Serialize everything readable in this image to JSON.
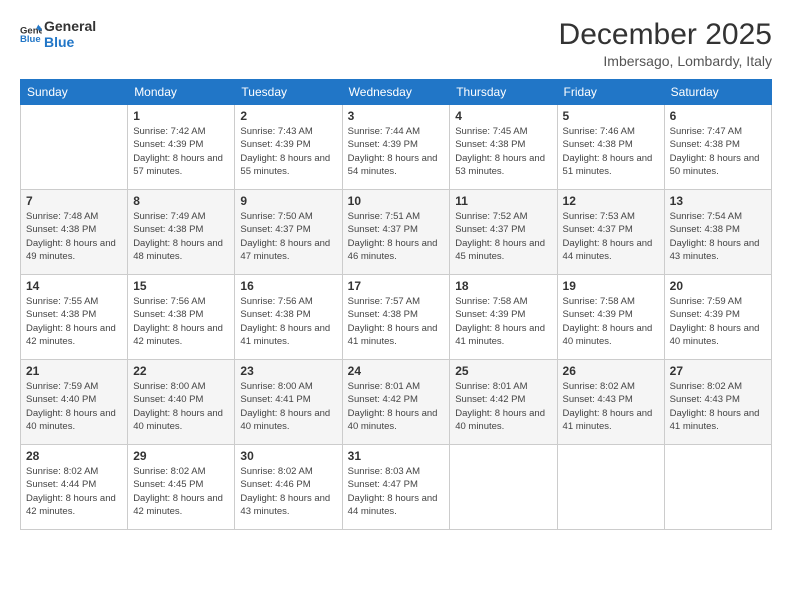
{
  "logo": {
    "line1": "General",
    "line2": "Blue"
  },
  "title": "December 2025",
  "location": "Imbersago, Lombardy, Italy",
  "weekdays": [
    "Sunday",
    "Monday",
    "Tuesday",
    "Wednesday",
    "Thursday",
    "Friday",
    "Saturday"
  ],
  "weeks": [
    [
      {
        "day": "",
        "sunrise": "",
        "sunset": "",
        "daylight": ""
      },
      {
        "day": "1",
        "sunrise": "7:42 AM",
        "sunset": "4:39 PM",
        "daylight": "8 hours and 57 minutes."
      },
      {
        "day": "2",
        "sunrise": "7:43 AM",
        "sunset": "4:39 PM",
        "daylight": "8 hours and 55 minutes."
      },
      {
        "day": "3",
        "sunrise": "7:44 AM",
        "sunset": "4:39 PM",
        "daylight": "8 hours and 54 minutes."
      },
      {
        "day": "4",
        "sunrise": "7:45 AM",
        "sunset": "4:38 PM",
        "daylight": "8 hours and 53 minutes."
      },
      {
        "day": "5",
        "sunrise": "7:46 AM",
        "sunset": "4:38 PM",
        "daylight": "8 hours and 51 minutes."
      },
      {
        "day": "6",
        "sunrise": "7:47 AM",
        "sunset": "4:38 PM",
        "daylight": "8 hours and 50 minutes."
      }
    ],
    [
      {
        "day": "7",
        "sunrise": "7:48 AM",
        "sunset": "4:38 PM",
        "daylight": "8 hours and 49 minutes."
      },
      {
        "day": "8",
        "sunrise": "7:49 AM",
        "sunset": "4:38 PM",
        "daylight": "8 hours and 48 minutes."
      },
      {
        "day": "9",
        "sunrise": "7:50 AM",
        "sunset": "4:37 PM",
        "daylight": "8 hours and 47 minutes."
      },
      {
        "day": "10",
        "sunrise": "7:51 AM",
        "sunset": "4:37 PM",
        "daylight": "8 hours and 46 minutes."
      },
      {
        "day": "11",
        "sunrise": "7:52 AM",
        "sunset": "4:37 PM",
        "daylight": "8 hours and 45 minutes."
      },
      {
        "day": "12",
        "sunrise": "7:53 AM",
        "sunset": "4:37 PM",
        "daylight": "8 hours and 44 minutes."
      },
      {
        "day": "13",
        "sunrise": "7:54 AM",
        "sunset": "4:38 PM",
        "daylight": "8 hours and 43 minutes."
      }
    ],
    [
      {
        "day": "14",
        "sunrise": "7:55 AM",
        "sunset": "4:38 PM",
        "daylight": "8 hours and 42 minutes."
      },
      {
        "day": "15",
        "sunrise": "7:56 AM",
        "sunset": "4:38 PM",
        "daylight": "8 hours and 42 minutes."
      },
      {
        "day": "16",
        "sunrise": "7:56 AM",
        "sunset": "4:38 PM",
        "daylight": "8 hours and 41 minutes."
      },
      {
        "day": "17",
        "sunrise": "7:57 AM",
        "sunset": "4:38 PM",
        "daylight": "8 hours and 41 minutes."
      },
      {
        "day": "18",
        "sunrise": "7:58 AM",
        "sunset": "4:39 PM",
        "daylight": "8 hours and 41 minutes."
      },
      {
        "day": "19",
        "sunrise": "7:58 AM",
        "sunset": "4:39 PM",
        "daylight": "8 hours and 40 minutes."
      },
      {
        "day": "20",
        "sunrise": "7:59 AM",
        "sunset": "4:39 PM",
        "daylight": "8 hours and 40 minutes."
      }
    ],
    [
      {
        "day": "21",
        "sunrise": "7:59 AM",
        "sunset": "4:40 PM",
        "daylight": "8 hours and 40 minutes."
      },
      {
        "day": "22",
        "sunrise": "8:00 AM",
        "sunset": "4:40 PM",
        "daylight": "8 hours and 40 minutes."
      },
      {
        "day": "23",
        "sunrise": "8:00 AM",
        "sunset": "4:41 PM",
        "daylight": "8 hours and 40 minutes."
      },
      {
        "day": "24",
        "sunrise": "8:01 AM",
        "sunset": "4:42 PM",
        "daylight": "8 hours and 40 minutes."
      },
      {
        "day": "25",
        "sunrise": "8:01 AM",
        "sunset": "4:42 PM",
        "daylight": "8 hours and 40 minutes."
      },
      {
        "day": "26",
        "sunrise": "8:02 AM",
        "sunset": "4:43 PM",
        "daylight": "8 hours and 41 minutes."
      },
      {
        "day": "27",
        "sunrise": "8:02 AM",
        "sunset": "4:43 PM",
        "daylight": "8 hours and 41 minutes."
      }
    ],
    [
      {
        "day": "28",
        "sunrise": "8:02 AM",
        "sunset": "4:44 PM",
        "daylight": "8 hours and 42 minutes."
      },
      {
        "day": "29",
        "sunrise": "8:02 AM",
        "sunset": "4:45 PM",
        "daylight": "8 hours and 42 minutes."
      },
      {
        "day": "30",
        "sunrise": "8:02 AM",
        "sunset": "4:46 PM",
        "daylight": "8 hours and 43 minutes."
      },
      {
        "day": "31",
        "sunrise": "8:03 AM",
        "sunset": "4:47 PM",
        "daylight": "8 hours and 44 minutes."
      },
      {
        "day": "",
        "sunrise": "",
        "sunset": "",
        "daylight": ""
      },
      {
        "day": "",
        "sunrise": "",
        "sunset": "",
        "daylight": ""
      },
      {
        "day": "",
        "sunrise": "",
        "sunset": "",
        "daylight": ""
      }
    ]
  ]
}
